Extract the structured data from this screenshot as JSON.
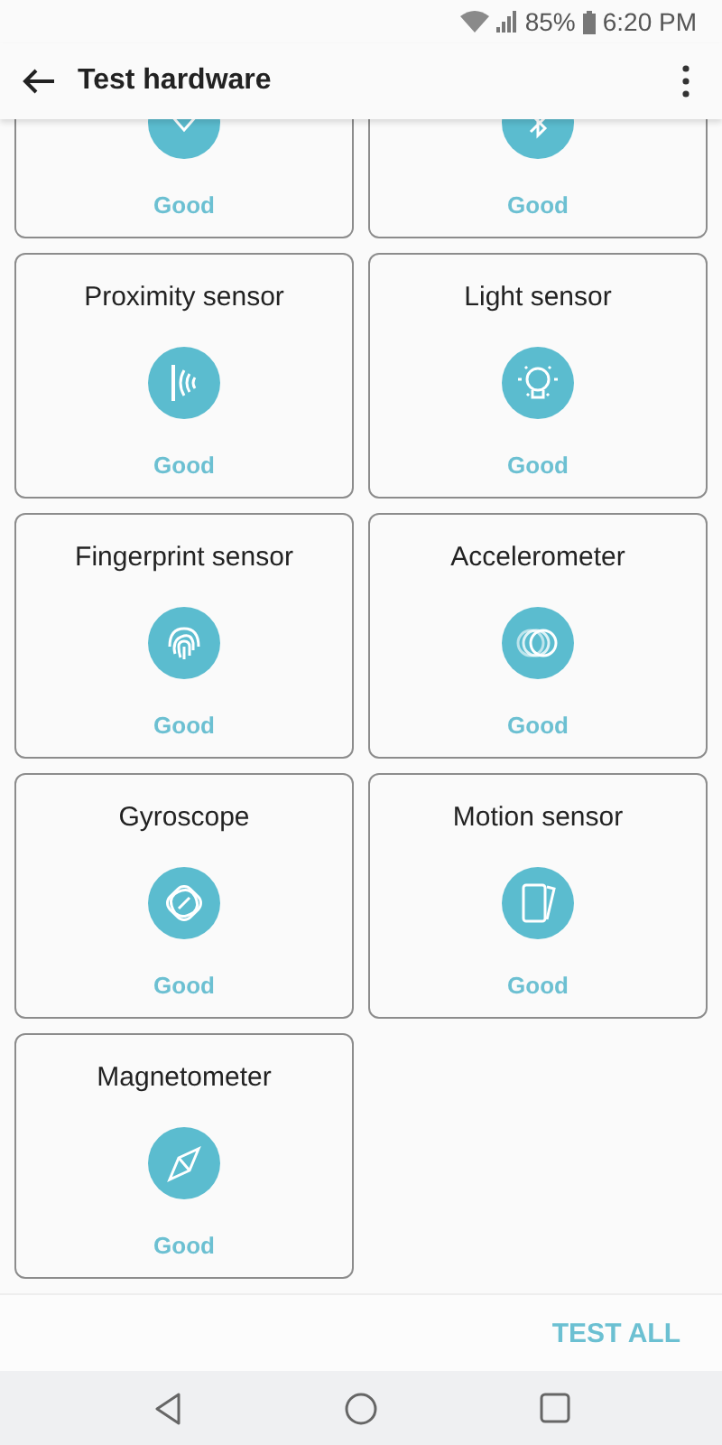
{
  "status_bar": {
    "battery": "85%",
    "time": "6:20 PM"
  },
  "app_bar": {
    "title": "Test hardware"
  },
  "cards": [
    {
      "status": "Good"
    },
    {
      "status": "Good"
    },
    {
      "title": "Proximity sensor",
      "status": "Good"
    },
    {
      "title": "Light sensor",
      "status": "Good"
    },
    {
      "title": "Fingerprint sensor",
      "status": "Good"
    },
    {
      "title": "Accelerometer",
      "status": "Good"
    },
    {
      "title": "Gyroscope",
      "status": "Good"
    },
    {
      "title": "Motion sensor",
      "status": "Good"
    },
    {
      "title": "Magnetometer",
      "status": "Good"
    }
  ],
  "footer": {
    "button": "TEST ALL"
  }
}
